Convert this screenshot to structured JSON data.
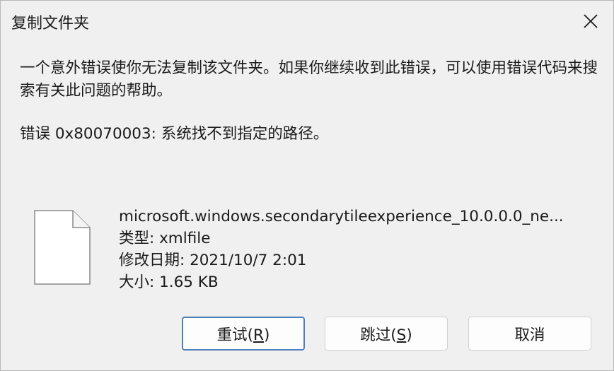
{
  "window": {
    "title": "复制文件夹",
    "close_icon": "close-icon"
  },
  "message": {
    "text": "一个意外错误使你无法复制该文件夹。如果你继续收到此错误，可以使用错误代码来搜索有关此问题的帮助。",
    "error": "错误 0x80070003: 系统找不到指定的路径。"
  },
  "file": {
    "icon": "document-icon",
    "name": "microsoft.windows.secondarytileexperience_10.0.0.0_ne...",
    "type": "类型: xmlfile",
    "modified": "修改日期: 2021/10/7 2:01",
    "size": "大小: 1.65 KB"
  },
  "buttons": {
    "retry": {
      "label": "重试(",
      "key": "R",
      "suffix": ")"
    },
    "skip": {
      "label": "跳过(",
      "key": "S",
      "suffix": ")"
    },
    "cancel": {
      "label": "取消"
    }
  },
  "colors": {
    "background": "#f0f0f0",
    "default_button_border": "#4d7fb8"
  }
}
